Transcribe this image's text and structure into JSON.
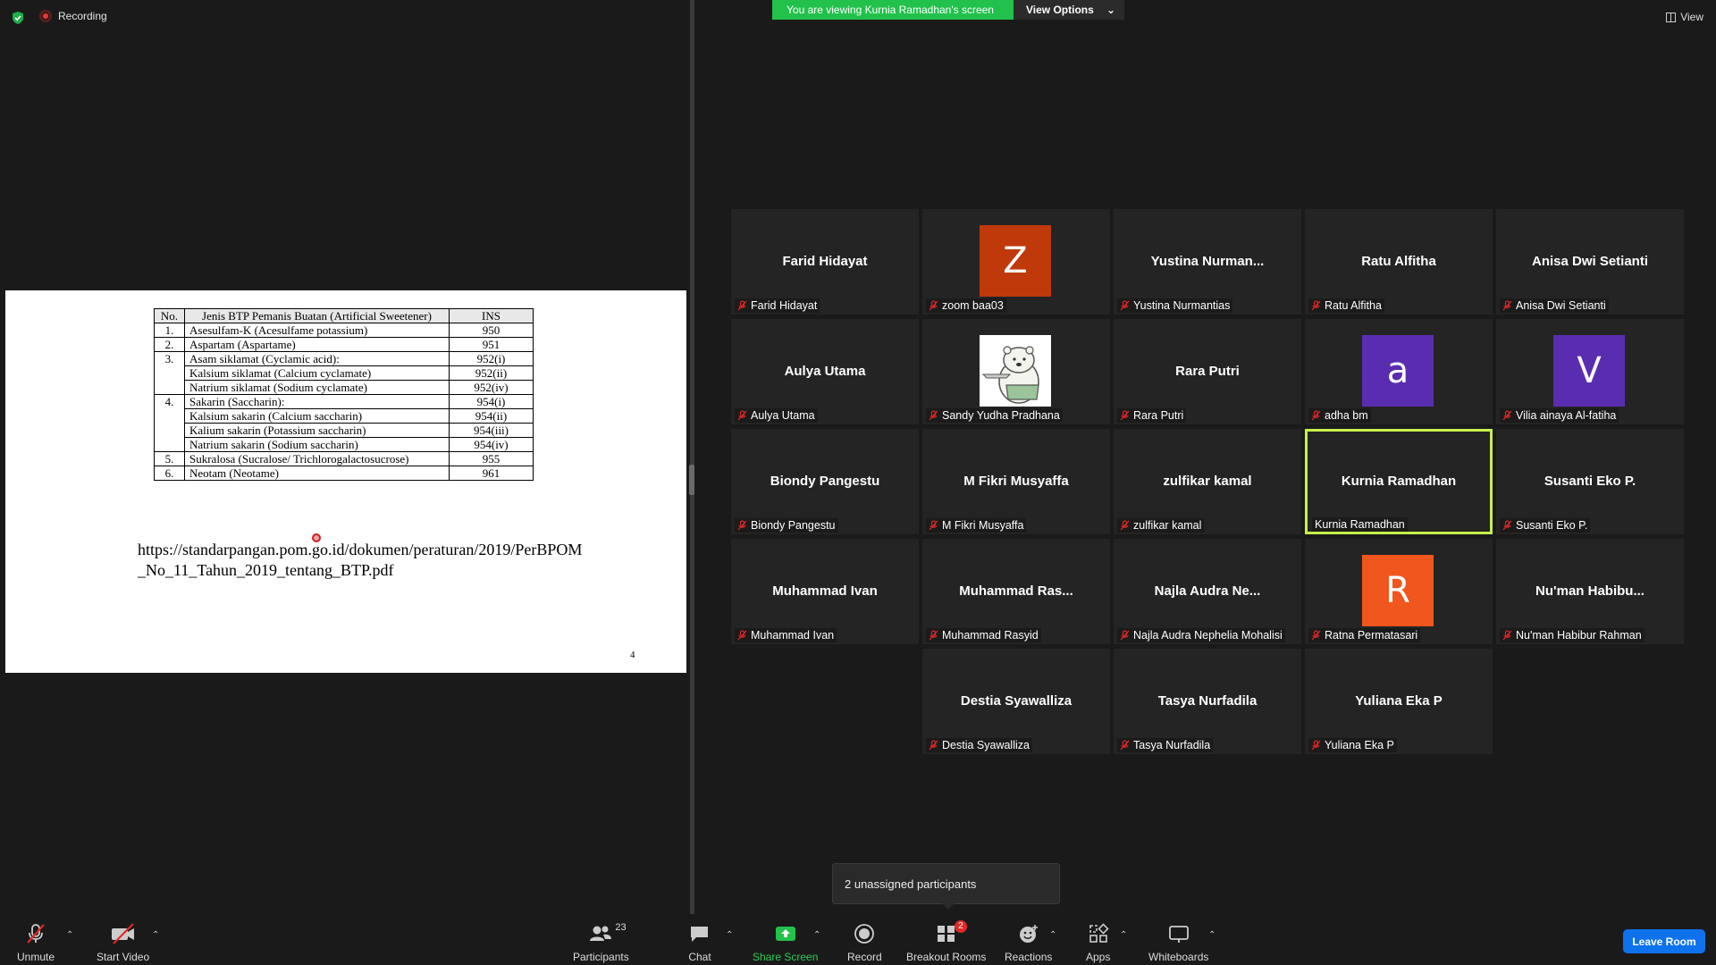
{
  "top": {
    "recording_label": "Recording",
    "banner_text": "You are viewing Kurnia Ramadhan's screen",
    "view_options": "View Options",
    "view_label": "View"
  },
  "slide": {
    "headers": {
      "no": "No.",
      "name": "Jenis BTP Pemanis Buatan (Artificial Sweetener)",
      "ins": "INS"
    },
    "rows": [
      {
        "no": "1.",
        "name": "Asesulfam-K (Acesulfame potassium)",
        "ins": "950"
      },
      {
        "no": "2.",
        "name": "Aspartam (Aspartame)",
        "ins": "951"
      },
      {
        "no": "3.",
        "name": "Asam siklamat (Cyclamic acid):",
        "ins": "952(i)"
      },
      {
        "no": "",
        "name": "Kalsium siklamat (Calcium cyclamate)",
        "ins": "952(ii)"
      },
      {
        "no": "",
        "name": "Natrium siklamat (Sodium cyclamate)",
        "ins": "952(iv)"
      },
      {
        "no": "4.",
        "name": "Sakarin (Saccharin):",
        "ins": "954(i)"
      },
      {
        "no": "",
        "name": "Kalsium sakarin (Calcium saccharin)",
        "ins": "954(ii)"
      },
      {
        "no": "",
        "name": "Kalium sakarin (Potassium saccharin)",
        "ins": "954(iii)"
      },
      {
        "no": "",
        "name": "Natrium sakarin (Sodium saccharin)",
        "ins": "954(iv)"
      },
      {
        "no": "5.",
        "name": "Sukralosa (Sucralose/ Trichlorogalactosucrose)",
        "ins": "955"
      },
      {
        "no": "6.",
        "name": "Neotam (Neotame)",
        "ins": "961"
      }
    ],
    "url": "https://standarpangan.pom.go.id/dokumen/peraturan/2019/PerBPOM_No_11_Tahun_2019_tentang_BTP.pdf",
    "page_number": "4"
  },
  "participants": [
    {
      "display": "Farid Hidayat",
      "label": "Farid Hidayat"
    },
    {
      "display": "Z",
      "label": "zoom baa03",
      "avatar_color": "#c0390b"
    },
    {
      "display": "Yustina  Nurman...",
      "label": "Yustina Nurmantias"
    },
    {
      "display": "Ratu Alfitha",
      "label": "Ratu Alfitha"
    },
    {
      "display": "Anisa Dwi Setianti",
      "label": "Anisa Dwi Setianti"
    },
    {
      "display": "Aulya Utama",
      "label": "Aulya Utama"
    },
    {
      "display": "",
      "label": "Sandy Yudha Pradhana",
      "avatar_image": "bear-avatar-icon"
    },
    {
      "display": "Rara Putri",
      "label": "Rara Putri"
    },
    {
      "display": "a",
      "label": "adha bm",
      "avatar_color": "#5a2db0"
    },
    {
      "display": "V",
      "label": "Vilia ainaya Al-fatiha",
      "avatar_color": "#5a2db0"
    },
    {
      "display": "Biondy Pangestu",
      "label": "Biondy Pangestu"
    },
    {
      "display": "M Fikri Musyaffa",
      "label": "M Fikri Musyaffa"
    },
    {
      "display": "zulfikar kamal",
      "label": "zulfikar kamal"
    },
    {
      "display": "Kurnia Ramadhan",
      "label": "Kurnia Ramadhan",
      "active": true
    },
    {
      "display": "Susanti Eko P.",
      "label": "Susanti Eko P."
    },
    {
      "display": "Muhammad Ivan",
      "label": "Muhammad Ivan"
    },
    {
      "display": "Muhammad  Ras...",
      "label": "Muhammad Rasyid"
    },
    {
      "display": "Najla  Audra  Ne...",
      "label": "Najla Audra Nephelia Mohalisi"
    },
    {
      "display": "R",
      "label": "Ratna Permatasari",
      "avatar_color": "#f0561d"
    },
    {
      "display": "Nu'man  Habibu...",
      "label": "Nu'man Habibur Rahman"
    },
    {
      "display": "Destia Syawalliza",
      "label": "Destia Syawalliza"
    },
    {
      "display": "Tasya Nurfadila",
      "label": "Tasya Nurfadila"
    },
    {
      "display": "Yuliana Eka P",
      "label": "Yuliana Eka P"
    }
  ],
  "popup": {
    "text": "2 unassigned participants"
  },
  "toolbar": {
    "unmute": "Unmute",
    "start_video": "Start Video",
    "participants": "Participants",
    "participants_count": "23",
    "chat": "Chat",
    "share_screen": "Share Screen",
    "record": "Record",
    "breakout_rooms": "Breakout Rooms",
    "breakout_badge": "2",
    "reactions": "Reactions",
    "apps": "Apps",
    "whiteboards": "Whiteboards",
    "leave_room": "Leave Room"
  },
  "colors": {
    "share_green": "#21c14b",
    "active_border": "#c6f04a",
    "leave_blue": "#0e72ed",
    "mic_muted_red": "#e02828"
  }
}
